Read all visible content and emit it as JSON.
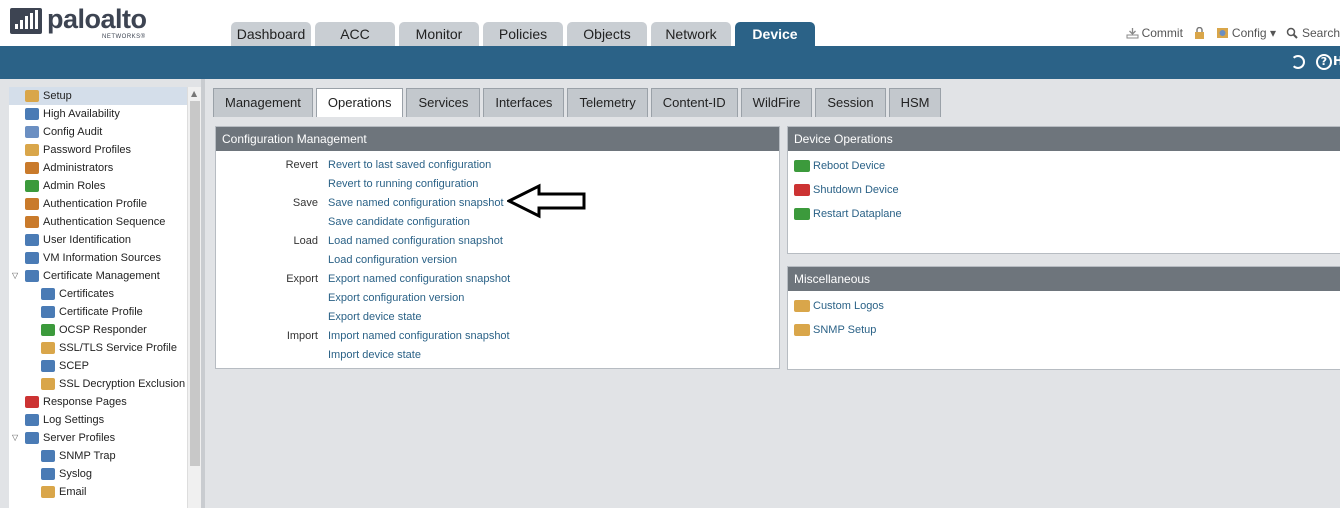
{
  "brand": {
    "name": "paloalto",
    "sub": "NETWORKS®"
  },
  "main_tabs": [
    "Dashboard",
    "ACC",
    "Monitor",
    "Policies",
    "Objects",
    "Network",
    "Device"
  ],
  "header_actions": {
    "commit": "Commit",
    "config": "Config ▾",
    "search": "Search"
  },
  "help_label": "H",
  "sidebar": {
    "items": [
      {
        "label": "Setup",
        "icon": "setup-icon",
        "color": "#d9a64a",
        "level": 0,
        "selected": true
      },
      {
        "label": "High Availability",
        "icon": "ha-icon",
        "color": "#4a7bb5",
        "level": 0
      },
      {
        "label": "Config Audit",
        "icon": "config-audit-icon",
        "color": "#6b8fc2",
        "level": 0
      },
      {
        "label": "Password Profiles",
        "icon": "password-icon",
        "color": "#d9a64a",
        "level": 0
      },
      {
        "label": "Administrators",
        "icon": "admin-icon",
        "color": "#c97a2b",
        "level": 0
      },
      {
        "label": "Admin Roles",
        "icon": "admin-roles-icon",
        "color": "#3c9a3c",
        "level": 0
      },
      {
        "label": "Authentication Profile",
        "icon": "auth-profile-icon",
        "color": "#c97a2b",
        "level": 0
      },
      {
        "label": "Authentication Sequence",
        "icon": "auth-seq-icon",
        "color": "#c97a2b",
        "level": 0
      },
      {
        "label": "User Identification",
        "icon": "user-id-icon",
        "color": "#4a7bb5",
        "level": 0
      },
      {
        "label": "VM Information Sources",
        "icon": "vm-icon",
        "color": "#4a7bb5",
        "level": 0
      },
      {
        "label": "Certificate Management",
        "icon": "cert-mgmt-icon",
        "color": "#4a7bb5",
        "level": 0,
        "expanded": true
      },
      {
        "label": "Certificates",
        "icon": "certificates-icon",
        "color": "#4a7bb5",
        "level": 1
      },
      {
        "label": "Certificate Profile",
        "icon": "cert-profile-icon",
        "color": "#4a7bb5",
        "level": 1
      },
      {
        "label": "OCSP Responder",
        "icon": "ocsp-icon",
        "color": "#3c9a3c",
        "level": 1
      },
      {
        "label": "SSL/TLS Service Profile",
        "icon": "lock-icon",
        "color": "#d9a64a",
        "level": 1
      },
      {
        "label": "SCEP",
        "icon": "scep-icon",
        "color": "#4a7bb5",
        "level": 1
      },
      {
        "label": "SSL Decryption Exclusion",
        "icon": "lock-icon",
        "color": "#d9a64a",
        "level": 1
      },
      {
        "label": "Response Pages",
        "icon": "response-pages-icon",
        "color": "#cc3333",
        "level": 0
      },
      {
        "label": "Log Settings",
        "icon": "log-settings-icon",
        "color": "#4a7bb5",
        "level": 0
      },
      {
        "label": "Server Profiles",
        "icon": "server-profiles-icon",
        "color": "#4a7bb5",
        "level": 0,
        "expanded": true
      },
      {
        "label": "SNMP Trap",
        "icon": "snmp-icon",
        "color": "#4a7bb5",
        "level": 1
      },
      {
        "label": "Syslog",
        "icon": "syslog-icon",
        "color": "#4a7bb5",
        "level": 1
      },
      {
        "label": "Email",
        "icon": "email-icon",
        "color": "#d9a64a",
        "level": 1
      }
    ]
  },
  "sub_tabs": [
    "Management",
    "Operations",
    "Services",
    "Interfaces",
    "Telemetry",
    "Content-ID",
    "WildFire",
    "Session",
    "HSM"
  ],
  "active_sub_tab": "Operations",
  "config_management": {
    "title": "Configuration Management",
    "rows": [
      {
        "label": "Revert",
        "link": "Revert to last saved configuration"
      },
      {
        "label": "",
        "link": "Revert to running configuration"
      },
      {
        "label": "Save",
        "link": "Save named configuration snapshot"
      },
      {
        "label": "",
        "link": "Save candidate configuration"
      },
      {
        "label": "Load",
        "link": "Load named configuration snapshot"
      },
      {
        "label": "",
        "link": "Load configuration version"
      },
      {
        "label": "Export",
        "link": "Export named configuration snapshot"
      },
      {
        "label": "",
        "link": "Export configuration version"
      },
      {
        "label": "",
        "link": "Export device state"
      },
      {
        "label": "Import",
        "link": "Import named configuration snapshot"
      },
      {
        "label": "",
        "link": "Import device state"
      }
    ]
  },
  "device_operations": {
    "title": "Device Operations",
    "items": [
      {
        "label": "Reboot Device",
        "icon": "reboot-icon",
        "color": "#3c9a3c"
      },
      {
        "label": "Shutdown Device",
        "icon": "shutdown-icon",
        "color": "#cc3333"
      },
      {
        "label": "Restart Dataplane",
        "icon": "restart-icon",
        "color": "#3c9a3c"
      }
    ]
  },
  "miscellaneous": {
    "title": "Miscellaneous",
    "items": [
      {
        "label": "Custom Logos",
        "icon": "custom-logos-icon",
        "color": "#d9a64a"
      },
      {
        "label": "SNMP Setup",
        "icon": "snmp-setup-icon",
        "color": "#d9a64a"
      }
    ]
  }
}
